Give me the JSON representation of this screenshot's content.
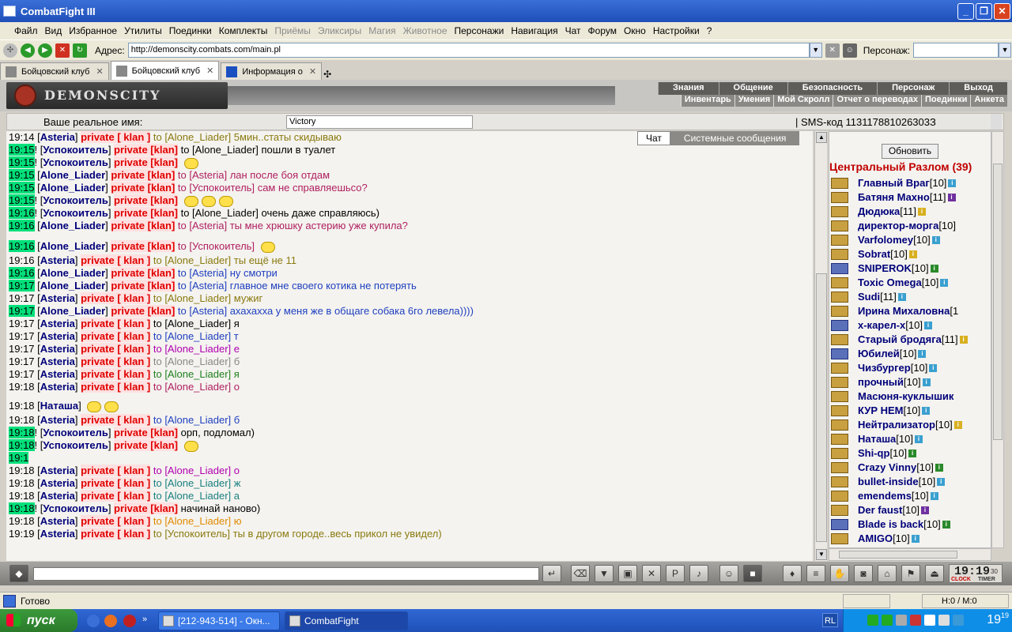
{
  "window": {
    "title": "CombatFight III"
  },
  "menu": [
    "Файл",
    "Вид",
    "Избранное",
    "Утилиты",
    "Поединки",
    "Комплекты",
    "Приёмы",
    "Эликсиры",
    "Магия",
    "Животное",
    "Персонажи",
    "Навигация",
    "Чат",
    "Форум",
    "Окно",
    "Настройки",
    "?"
  ],
  "menu_disabled": [
    "Приёмы",
    "Эликсиры",
    "Магия",
    "Животное"
  ],
  "address": {
    "label": "Адрес:",
    "url": "http://demonscity.combats.com/main.pl",
    "persona_label": "Персонаж:"
  },
  "tabs": [
    {
      "label": "Бойцовский клуб",
      "active": false
    },
    {
      "label": "Бойцовский клуб",
      "active": true
    },
    {
      "label": "Информация о",
      "active": false
    }
  ],
  "game": {
    "logo": "DEMONSCITY",
    "nav_top": [
      "Знания",
      "Общение",
      "Безопасность",
      "Персонаж",
      "Выход"
    ],
    "nav_bottom": [
      "Инвентарь",
      "Умения",
      "Мой Скролл",
      "Отчет о переводах",
      "Поединки",
      "Анкета"
    ],
    "real_name_label": "Ваше реальное имя:",
    "real_name_value": "Victory",
    "sms_code": "| SMS-код 113117881026303З"
  },
  "chat_tabs": {
    "chat": "Чат",
    "system": "Системные сообщения"
  },
  "chat_lines": [
    {
      "time": "19:14",
      "hl": false,
      "ex": "",
      "nick": "Asteria",
      "priv": "private [ klan ]",
      "to": "to [Alone_Liader]",
      "msg": "5мин..статы скидываю",
      "c": "ol",
      "tall": ""
    },
    {
      "time": "19:15",
      "hl": true,
      "ex": "!",
      "nick": "Успокоитель",
      "priv": "private [klan]",
      "to": "to [Alone_Liader]",
      "msg": "пошли в туалет",
      "c": "to",
      "tall": ""
    },
    {
      "time": "19:15",
      "hl": true,
      "ex": "!",
      "nick": "Успокоитель",
      "priv": "private [klan]",
      "to": "",
      "msg": "",
      "c": "to",
      "tall": "",
      "smile": 1
    },
    {
      "time": "19:15",
      "hl": true,
      "ex": "",
      "nick": "Alone_Liader",
      "priv": "private [klan]",
      "to": "to [Asteria]",
      "msg": "лан после боя отдам",
      "c": "rd",
      "tall": ""
    },
    {
      "time": "19:15",
      "hl": true,
      "ex": "",
      "nick": "Alone_Liader",
      "priv": "private [klan]",
      "to": "to [Успокоитель]",
      "msg": "сам не справляешьсо?",
      "c": "rd",
      "tall": ""
    },
    {
      "time": "19:15",
      "hl": true,
      "ex": "!",
      "nick": "Успокоитель",
      "priv": "private [klan]",
      "to": "",
      "msg": "",
      "c": "to",
      "tall": "",
      "smile": 3
    },
    {
      "time": "19:16",
      "hl": true,
      "ex": "!",
      "nick": "Успокоитель",
      "priv": "private [klan]",
      "to": "to [Alone_Liader]",
      "msg": "очень даже справляюсь)",
      "c": "to",
      "tall": ""
    },
    {
      "time": "19:16",
      "hl": true,
      "ex": "",
      "nick": "Alone_Liader",
      "priv": "private [klan]",
      "to": "to [Asteria]",
      "msg": "ты мне хрюшку астерию уже купила?",
      "c": "rd",
      "tall": ""
    },
    {
      "time": "19:16",
      "hl": true,
      "ex": "",
      "nick": "Alone_Liader",
      "priv": "private [klan]",
      "to": "to [Успокоитель]",
      "msg": "",
      "c": "rd",
      "tall": "taller",
      "smile": 1
    },
    {
      "time": "19:16",
      "hl": false,
      "ex": "",
      "nick": "Asteria",
      "priv": "private [ klan ]",
      "to": "to [Alone_Liader]",
      "msg": "ты ещё не 11",
      "c": "ol",
      "tall": ""
    },
    {
      "time": "19:16",
      "hl": true,
      "ex": "",
      "nick": "Alone_Liader",
      "priv": "private [klan]",
      "to": "to [Asteria]",
      "msg": "ну смотри",
      "c": "bl",
      "tall": ""
    },
    {
      "time": "19:17",
      "hl": true,
      "ex": "",
      "nick": "Alone_Liader",
      "priv": "private [klan]",
      "to": "to [Asteria]",
      "msg": "главное мне своего котика не потерять",
      "c": "bl",
      "tall": ""
    },
    {
      "time": "19:17",
      "hl": false,
      "ex": "",
      "nick": "Asteria",
      "priv": "private [ klan ]",
      "to": "to [Alone_Liader]",
      "msg": "мужиг",
      "c": "ol",
      "tall": ""
    },
    {
      "time": "19:17",
      "hl": true,
      "ex": "",
      "nick": "Alone_Liader",
      "priv": "private [klan]",
      "to": "to [Asteria]",
      "msg": "ахахахха у меня же в общаге собака 6го левела))))",
      "c": "bl",
      "tall": ""
    },
    {
      "time": "19:17",
      "hl": false,
      "ex": "",
      "nick": "Asteria",
      "priv": "private [ klan ]",
      "to": "to [Alone_Liader]",
      "msg": "я",
      "c": "to",
      "tall": ""
    },
    {
      "time": "19:17",
      "hl": false,
      "ex": "",
      "nick": "Asteria",
      "priv": "private [ klan ]",
      "to": "to [Alone_Liader]",
      "msg": "т",
      "c": "bl",
      "tall": ""
    },
    {
      "time": "19:17",
      "hl": false,
      "ex": "",
      "nick": "Asteria",
      "priv": "private [ klan ]",
      "to": "to [Alone_Liader]",
      "msg": "е",
      "c": "pu",
      "tall": ""
    },
    {
      "time": "19:17",
      "hl": false,
      "ex": "",
      "nick": "Asteria",
      "priv": "private [ klan ]",
      "to": "to [Alone_Liader]",
      "msg": "б",
      "c": "gy",
      "tall": ""
    },
    {
      "time": "19:17",
      "hl": false,
      "ex": "",
      "nick": "Asteria",
      "priv": "private [ klan ]",
      "to": "to [Alone_Liader]",
      "msg": "я",
      "c": "gr",
      "tall": ""
    },
    {
      "time": "19:18",
      "hl": false,
      "ex": "",
      "nick": "Asteria",
      "priv": "private [ klan ]",
      "to": "to [Alone_Liader]",
      "msg": "о",
      "c": "rd",
      "tall": ""
    },
    {
      "time": "19:18",
      "hl": false,
      "ex": "",
      "nick": "Наташа",
      "priv": "",
      "to": "",
      "msg": "",
      "c": "to",
      "tall": "tall",
      "smile": 2
    },
    {
      "time": "19:18",
      "hl": false,
      "ex": "",
      "nick": "Asteria",
      "priv": "private [ klan ]",
      "to": "to [Alone_Liader]",
      "msg": "б",
      "c": "bl",
      "tall": ""
    },
    {
      "time": "19:18",
      "hl": true,
      "ex": "!",
      "nick": "Успокоитель",
      "priv": "private [klan]",
      "to": "",
      "msg": "орп, подломал)",
      "c": "to",
      "tall": ""
    },
    {
      "time": "19:18",
      "hl": true,
      "ex": "!",
      "nick": "Успокоитель",
      "priv": "private [klan]",
      "to": "",
      "msg": "",
      "c": "to",
      "tall": "",
      "smile": 1
    },
    {
      "time": "19:1",
      "hl": true,
      "ex": "",
      "nick": "",
      "priv": "",
      "to": "",
      "msg": "",
      "c": "to",
      "tall": ""
    },
    {
      "time": "19:18",
      "hl": false,
      "ex": "",
      "nick": "Asteria",
      "priv": "private [ klan ]",
      "to": "to [Alone_Liader]",
      "msg": "о",
      "c": "pu",
      "tall": ""
    },
    {
      "time": "19:18",
      "hl": false,
      "ex": "",
      "nick": "Asteria",
      "priv": "private [ klan ]",
      "to": "to [Alone_Liader]",
      "msg": "ж",
      "c": "tl",
      "tall": ""
    },
    {
      "time": "19:18",
      "hl": false,
      "ex": "",
      "nick": "Asteria",
      "priv": "private [ klan ]",
      "to": "to [Alone_Liader]",
      "msg": "а",
      "c": "tl",
      "tall": ""
    },
    {
      "time": "19:18",
      "hl": true,
      "ex": "!",
      "nick": "Успокоитель",
      "priv": "private [klan]",
      "to": "",
      "msg": "начинай наново)",
      "c": "to",
      "tall": ""
    },
    {
      "time": "19:18",
      "hl": false,
      "ex": "",
      "nick": "Asteria",
      "priv": "private [ klan ]",
      "to": "to [Alone_Liader]",
      "msg": "ю",
      "c": "org",
      "tall": ""
    },
    {
      "time": "19:19",
      "hl": false,
      "ex": "",
      "nick": "Asteria",
      "priv": "private [ klan ]",
      "to": "to [Успокоитель]",
      "msg": "ты в другом городе..весь прикол не увидел)",
      "c": "ol",
      "tall": ""
    }
  ],
  "right_panel": {
    "refresh_label": "Обновить",
    "location": "Центральный Разлом (39)",
    "users": [
      {
        "name": "Главный Враг",
        "lvl": "[10]",
        "i": "t",
        "b": false
      },
      {
        "name": "Батяня Махно",
        "lvl": "[11]",
        "i": "p",
        "b": false
      },
      {
        "name": "Дюдюка",
        "lvl": "[11]",
        "i": "y",
        "b": false
      },
      {
        "name": "директор-морга",
        "lvl": "[10]",
        "i": "",
        "b": false
      },
      {
        "name": "Varfolomey",
        "lvl": "[10]",
        "i": "t",
        "b": false
      },
      {
        "name": "Sobrat",
        "lvl": "[10]",
        "i": "y",
        "b": false
      },
      {
        "name": "SNIPEROK",
        "lvl": "[10]",
        "i": "g",
        "b": true
      },
      {
        "name": "Toxic Omega",
        "lvl": "[10]",
        "i": "t",
        "b": false
      },
      {
        "name": "Sudi",
        "lvl": "[11]",
        "i": "t",
        "b": false
      },
      {
        "name": "Ирина Михаловна",
        "lvl": "[1",
        "i": "",
        "b": false
      },
      {
        "name": "х-карел-х",
        "lvl": "[10]",
        "i": "t",
        "b": true
      },
      {
        "name": "Старый бродяга",
        "lvl": "[11]",
        "i": "y",
        "b": false
      },
      {
        "name": "Юбилей",
        "lvl": "[10]",
        "i": "t",
        "b": true
      },
      {
        "name": "Чизбургер",
        "lvl": "[10]",
        "i": "t",
        "b": false
      },
      {
        "name": "прочный",
        "lvl": "[10]",
        "i": "t",
        "b": false
      },
      {
        "name": "Масюня-куклышик",
        "lvl": "",
        "i": "",
        "b": false
      },
      {
        "name": "КУР НЕМ",
        "lvl": "[10]",
        "i": "t",
        "b": false
      },
      {
        "name": "Нейтрализатор",
        "lvl": "[10]",
        "i": "y",
        "b": false
      },
      {
        "name": "Наташа",
        "lvl": "[10]",
        "i": "t",
        "b": false
      },
      {
        "name": "Shi-qp",
        "lvl": "[10]",
        "i": "g",
        "b": false
      },
      {
        "name": "Crazy Vinny",
        "lvl": "[10]",
        "i": "g",
        "b": false
      },
      {
        "name": "bullet-inside",
        "lvl": "[10]",
        "i": "t",
        "b": false
      },
      {
        "name": "emendems",
        "lvl": "[10]",
        "i": "t",
        "b": false
      },
      {
        "name": "Der faust",
        "lvl": "[10]",
        "i": "p",
        "b": false
      },
      {
        "name": "Blade is back",
        "lvl": "[10]",
        "i": "g",
        "b": true
      },
      {
        "name": "AMIGO",
        "lvl": "[10]",
        "i": "t",
        "b": false
      }
    ]
  },
  "clock": {
    "time": "19:19",
    "seconds": "30",
    "clock_label": "CLOCK",
    "timer_label": "TIMER"
  },
  "status": {
    "text": "Готово",
    "hm": "H:0 / M:0"
  },
  "taskbar": {
    "start": "пуск",
    "items": [
      "[212-943-514] - Окн...",
      "CombatFight"
    ],
    "lang": "RL",
    "time": "19",
    "time_sup": "19"
  },
  "colors": {
    "highlight": "#00e07a",
    "private": "#e00000",
    "nick": "#00007a",
    "location": "#c00000"
  }
}
